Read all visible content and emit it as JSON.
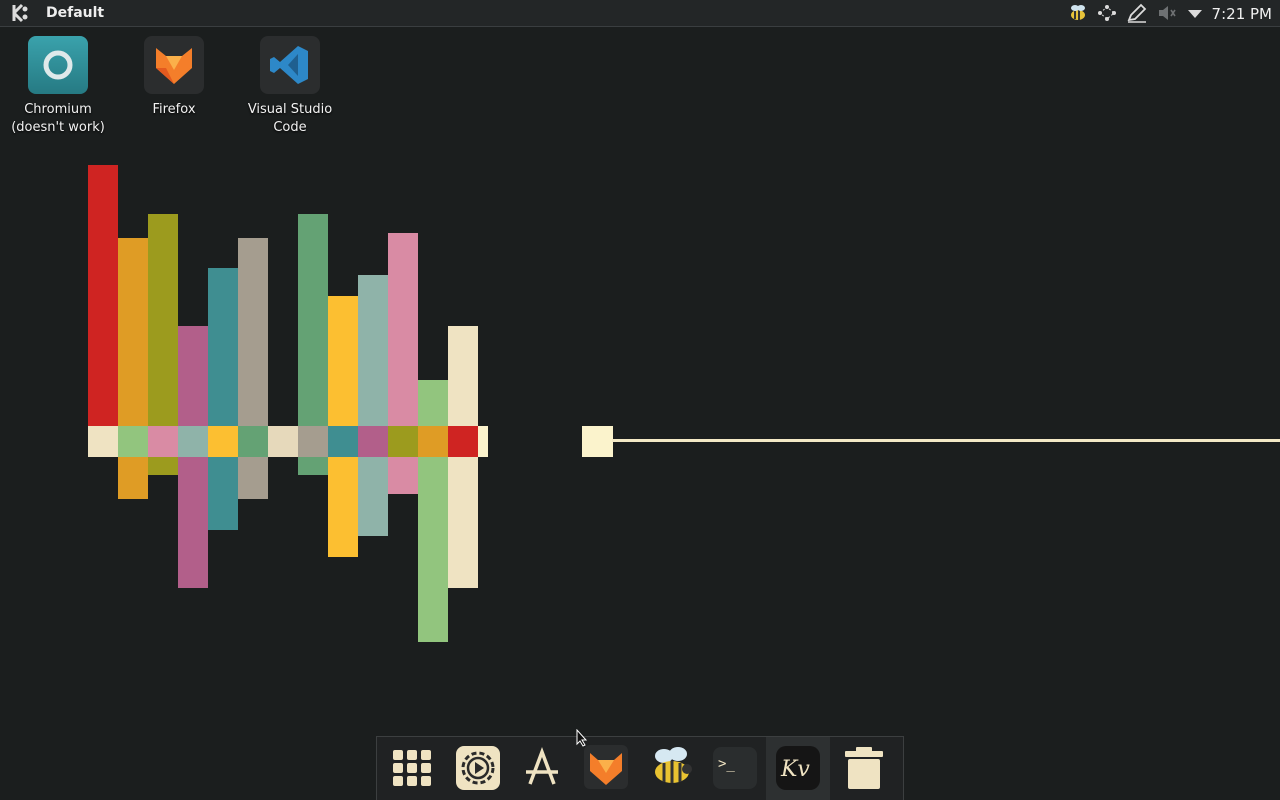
{
  "panel": {
    "activity": "Default",
    "clock": "7:21 PM",
    "tray_icons": [
      "bee-icon",
      "network-icon",
      "pen-icon",
      "volume-muted-icon",
      "expand-arrow-icon"
    ]
  },
  "desktop": {
    "icons": [
      {
        "name": "chromium",
        "label": "Chromium (doesn't work)"
      },
      {
        "name": "firefox",
        "label": "Firefox"
      },
      {
        "name": "vscode",
        "label": "Visual Studio Code"
      }
    ]
  },
  "equalizer": {
    "colors": {
      "red": "#cf2422",
      "orange": "#df9c25",
      "olive": "#9c9b1e",
      "mauve": "#b25f8a",
      "teal": "#3f8e91",
      "taupe": "#a59d8f",
      "green": "#64a274",
      "yellow": "#fcbf31",
      "sage": "#8fb3a9",
      "pink": "#d98ba4",
      "lightgreen": "#92c57e",
      "cream": "#efe3c2"
    }
  },
  "dock": {
    "items": [
      {
        "name": "app-grid-icon"
      },
      {
        "name": "settings-icon"
      },
      {
        "name": "text-editor-icon"
      },
      {
        "name": "firefox-icon"
      },
      {
        "name": "bee-app-icon"
      },
      {
        "name": "terminal-icon",
        "text": ">_"
      },
      {
        "name": "kv-app-icon",
        "text": "Kv"
      },
      {
        "name": "trash-icon"
      }
    ]
  }
}
